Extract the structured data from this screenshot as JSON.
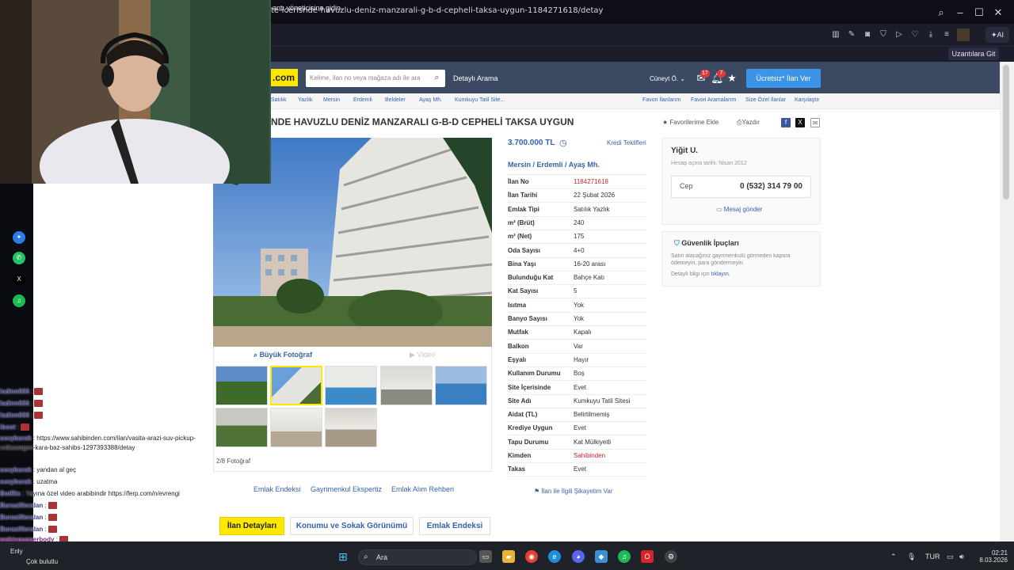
{
  "browser": {
    "url": "te-icerisnde-havuzlu-deniz-manzarali-g-b-d-cepheli-taksa-uygun-1184271618/detay",
    "ai_label": "AI",
    "info_text": "antı yöneticisine gidin.",
    "extensions_button": "Uzantılara Git"
  },
  "header": {
    "logo": ".com",
    "search_placeholder": "Kelime, ilan no veya mağaza adı ile ara",
    "advanced_search": "Detaylı Arama",
    "user": "Cüneyt Ö.",
    "messages_count": "17",
    "notifications_count": "7",
    "post_button": "Ücretsiz* İlan Ver"
  },
  "breadcrumbs": [
    "Satılık",
    "Yazlık",
    "Mersin",
    "Erdemli",
    "Beldeler",
    "Ayaş Mh.",
    "Kumkuyu Tatil Site..."
  ],
  "top_links": [
    "Favori İlanlarım",
    "Favori Aramalarım",
    "Size Özel İlanlar",
    "Karşılaştır"
  ],
  "listing": {
    "title": "NDE HAVUZLU DENİZ MANZARALI G-B-D CEPHELİ TAKSA UYGUN",
    "add_favorite": "Favorilerime Ekle",
    "print": "Yazdır",
    "price": "3.700.000 TL",
    "credit_offers": "Kredi Teklifleri",
    "location": [
      "Mersin",
      "Erdemli",
      "Ayaş Mh."
    ],
    "big_photo": "Büyük Fotoğraf",
    "video": "Video",
    "photo_count": "2/8 Fotoğraf"
  },
  "details": [
    {
      "label": "İlan No",
      "value": "1184271618",
      "red": true
    },
    {
      "label": "İlan Tarihi",
      "value": "22 Şubat 2026"
    },
    {
      "label": "Emlak Tipi",
      "value": "Satılık Yazlık"
    },
    {
      "label": "m² (Brüt)",
      "value": "240"
    },
    {
      "label": "m² (Net)",
      "value": "175"
    },
    {
      "label": "Oda Sayısı",
      "value": "4+0"
    },
    {
      "label": "Bina Yaşı",
      "value": "16-20 arası"
    },
    {
      "label": "Bulunduğu Kat",
      "value": "Bahçe Katı"
    },
    {
      "label": "Kat Sayısı",
      "value": "5"
    },
    {
      "label": "Isıtma",
      "value": "Yok"
    },
    {
      "label": "Banyo Sayısı",
      "value": "Yok"
    },
    {
      "label": "Mutfak",
      "value": "Kapalı"
    },
    {
      "label": "Balkon",
      "value": "Var"
    },
    {
      "label": "Eşyalı",
      "value": "Hayır"
    },
    {
      "label": "Kullanım Durumu",
      "value": "Boş"
    },
    {
      "label": "Site İçerisinde",
      "value": "Evet"
    },
    {
      "label": "Site Adı",
      "value": "Kumkuyu Tatil Sitesi"
    },
    {
      "label": "Aidat (TL)",
      "value": "Belirtilmemiş"
    },
    {
      "label": "Krediye Uygun",
      "value": "Evet"
    },
    {
      "label": "Tapu Durumu",
      "value": "Kat Mülkiyetli"
    },
    {
      "label": "Kimden",
      "value": "Sahibinden",
      "red": true
    },
    {
      "label": "Takas",
      "value": "Evet"
    }
  ],
  "seller": {
    "name": "Yiğit U.",
    "since": "Hesap açma tarihi: Nisan 2012",
    "phone_label": "Cep",
    "phone": "0 (532) 314 79 00",
    "message": "Mesaj gönder"
  },
  "safety": {
    "title": "Güvenlik İpuçları",
    "text": "Satın alacağınız gayrimenkulü görmeden kapora ödemeyin, para göndermeyin.",
    "link_prefix": "Detaylı bilgi için",
    "link": "tıklayın."
  },
  "bottom_links": [
    "Emlak Endeksi",
    "Gayrimenkul Ekspertiz",
    "Emlak Alım Rehberi"
  ],
  "report": "İlan ile İlgili Şikayetim Var",
  "tabs": [
    "İlan Detayları",
    "Konumu ve Sokak Görünümü",
    "Emlak Endeksi"
  ],
  "chat": [
    {
      "user": "ladinn666",
      "msg": ":"
    },
    {
      "user": "ladinn666",
      "msg": ":"
    },
    {
      "user": "ladinn666",
      "msg": ":"
    },
    {
      "user": "iboot",
      "msg": ":"
    },
    {
      "user": "sexyburak",
      "msg": ": https://www.sahibinden.com/ilan/vasita-arazi-suv-pickup-volkswagen-kara-baz-sahibs-1297393388/detay"
    },
    {
      "user": "sexyburak",
      "msg": ": yandan al geç"
    },
    {
      "user": "sexyburak",
      "msg": ": uzatma"
    },
    {
      "user": "BotRix",
      "msg": ": Yayına özel video arabibindir https://ferp.com/n/evrengi"
    },
    {
      "user": "BurasiNeralan",
      "msg": ":"
    },
    {
      "user": "BurasiNeralan",
      "msg": ":"
    },
    {
      "user": "BurasiNeralan",
      "msg": ":"
    },
    {
      "user": "wakingupperbody",
      "msg": ":"
    }
  ],
  "taskbar": {
    "weather_temp": "Enly",
    "weather_text": "Çok bulutlu",
    "search": "Ara",
    "language": "TUR",
    "time": "02:21",
    "date": "8.03.2026"
  },
  "colors": {
    "brand_yellow": "#ffe800",
    "header_blue": "#3b4963",
    "link_blue": "#3563aa",
    "accent_red": "#c8262d",
    "post_button": "#3c94e8"
  }
}
